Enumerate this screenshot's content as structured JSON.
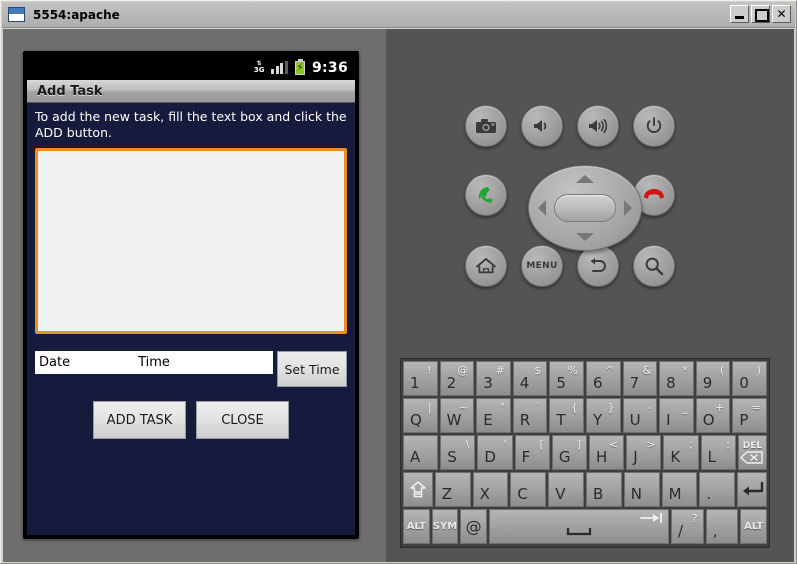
{
  "window": {
    "title": "5554:apache",
    "icon": "window-icon",
    "buttons": [
      {
        "name": "minimize",
        "glyph": "_"
      },
      {
        "name": "maximize",
        "glyph": "□"
      },
      {
        "name": "close",
        "glyph": "✕"
      }
    ]
  },
  "device": {
    "statusbar": {
      "network": "3G",
      "network_top": "↑↓",
      "battery_glyph": "⚡",
      "clock": "9:36"
    },
    "dialog": {
      "title": "Add Task",
      "instructions": "To add the new task, fill the text box and click the ADD button.",
      "task_input_value": "",
      "task_input_border_color": "#ef8c22",
      "date_label": "Date",
      "time_label": "Time",
      "set_time_label": "Set Time",
      "add_task_label": "ADD TASK",
      "close_label": "CLOSE",
      "background_color": "#161b3d"
    }
  },
  "emulator_controls": [
    {
      "name": "camera-button",
      "icon": "camera-icon"
    },
    {
      "name": "volume-down-button",
      "icon": "volume-down-icon"
    },
    {
      "name": "volume-up-button",
      "icon": "volume-up-icon"
    },
    {
      "name": "power-button",
      "icon": "power-icon"
    },
    {
      "name": "call-button",
      "icon": "phone-green-icon"
    },
    {
      "name": "end-call-button",
      "icon": "phone-red-icon"
    },
    {
      "name": "home-button",
      "icon": "home-icon"
    },
    {
      "name": "menu-button",
      "icon": "menu-icon",
      "label": "MENU"
    },
    {
      "name": "back-button",
      "icon": "back-arrow-icon"
    },
    {
      "name": "search-button",
      "icon": "search-icon"
    }
  ],
  "dpad": {
    "name": "dpad",
    "up": "▲",
    "down": "▼",
    "left": "◀",
    "right": "▶",
    "center": "select"
  },
  "keyboard": {
    "rows": [
      [
        {
          "main": "1",
          "sub": "!"
        },
        {
          "main": "2",
          "sub": "@"
        },
        {
          "main": "3",
          "sub": "#"
        },
        {
          "main": "4",
          "sub": "$"
        },
        {
          "main": "5",
          "sub": "%"
        },
        {
          "main": "6",
          "sub": "^"
        },
        {
          "main": "7",
          "sub": "&"
        },
        {
          "main": "8",
          "sub": "*"
        },
        {
          "main": "9",
          "sub": "("
        },
        {
          "main": "0",
          "sub": ")"
        }
      ],
      [
        {
          "main": "Q",
          "sub": "|"
        },
        {
          "main": "W",
          "sub": "~"
        },
        {
          "main": "E",
          "sub": "\""
        },
        {
          "main": "R",
          "sub": "`"
        },
        {
          "main": "T",
          "sub": "{"
        },
        {
          "main": "Y",
          "sub": "}"
        },
        {
          "main": "U",
          "sub": "-"
        },
        {
          "main": "I",
          "sub": "_"
        },
        {
          "main": "O",
          "sub": "+"
        },
        {
          "main": "P",
          "sub": "="
        }
      ],
      [
        {
          "main": "A",
          "sub": ""
        },
        {
          "main": "S",
          "sub": "\\"
        },
        {
          "main": "D",
          "sub": "'"
        },
        {
          "main": "F",
          "sub": "["
        },
        {
          "main": "G",
          "sub": "]"
        },
        {
          "main": "H",
          "sub": "<"
        },
        {
          "main": "J",
          "sub": ">"
        },
        {
          "main": "K",
          "sub": ";"
        },
        {
          "main": "L",
          "sub": ":"
        },
        {
          "main": "DEL",
          "sub": "",
          "special": "delete"
        }
      ],
      [
        {
          "main": "",
          "sub": "",
          "special": "shift"
        },
        {
          "main": "Z",
          "sub": ""
        },
        {
          "main": "X",
          "sub": ""
        },
        {
          "main": "C",
          "sub": ""
        },
        {
          "main": "V",
          "sub": ""
        },
        {
          "main": "B",
          "sub": ""
        },
        {
          "main": "N",
          "sub": ""
        },
        {
          "main": "M",
          "sub": ""
        },
        {
          "main": ".",
          "sub": ""
        },
        {
          "main": "",
          "sub": "",
          "special": "enter"
        }
      ],
      [
        {
          "main": "ALT",
          "sub": "",
          "special": "alt-left"
        },
        {
          "main": "SYM",
          "sub": "",
          "special": "sym"
        },
        {
          "main": "@",
          "sub": ""
        },
        {
          "main": "",
          "sub": "",
          "special": "space"
        },
        {
          "main": "/",
          "sub": "?"
        },
        {
          "main": ",",
          "sub": ""
        },
        {
          "main": "ALT",
          "sub": "",
          "special": "alt-right"
        }
      ]
    ]
  }
}
